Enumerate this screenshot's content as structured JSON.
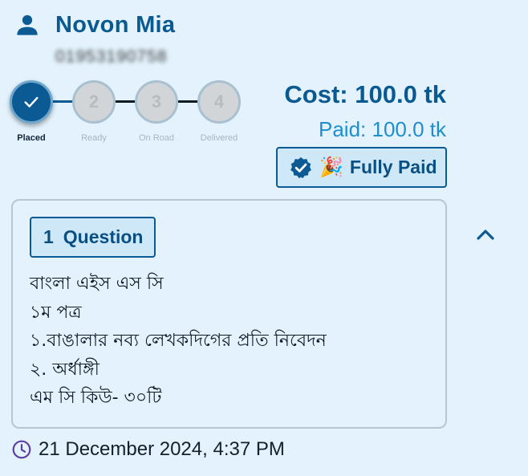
{
  "customer": {
    "name": "Novon Mia",
    "phone": "01953190758"
  },
  "order": {
    "stages": [
      {
        "label": "Placed",
        "number": "1",
        "state": "done"
      },
      {
        "label": "Ready",
        "number": "2",
        "state": "pending"
      },
      {
        "label": "On Road",
        "number": "3",
        "state": "pending"
      },
      {
        "label": "Delivered",
        "number": "4",
        "state": "pending"
      }
    ],
    "cost_text": "Cost: 100.0 tk",
    "paid_text": "Paid: 100.0 tk",
    "payment_status": "Fully Paid",
    "payment_emoji": "🎉"
  },
  "question": {
    "count": "1",
    "title": "Question",
    "lines": [
      "বাংলা এইস এস সি",
      "১ম পত্র",
      "১.বাঙালার নব্য লেখকদিগের প্রতি নিবেদন",
      "২. অর্ধাঙ্গী",
      "এম সি কিউ- ৩০টি"
    ]
  },
  "timestamp": "21 December 2024, 4:37 PM",
  "colors": {
    "primary": "#0b5a93",
    "accent": "#1d8fd0",
    "background": "#e3f2fc",
    "clock": "#5a3fa0"
  },
  "icons": {
    "user": "person-icon",
    "done": "check-icon",
    "verified": "verified-badge-icon",
    "collapse": "chevron-up-icon",
    "time": "clock-icon"
  }
}
